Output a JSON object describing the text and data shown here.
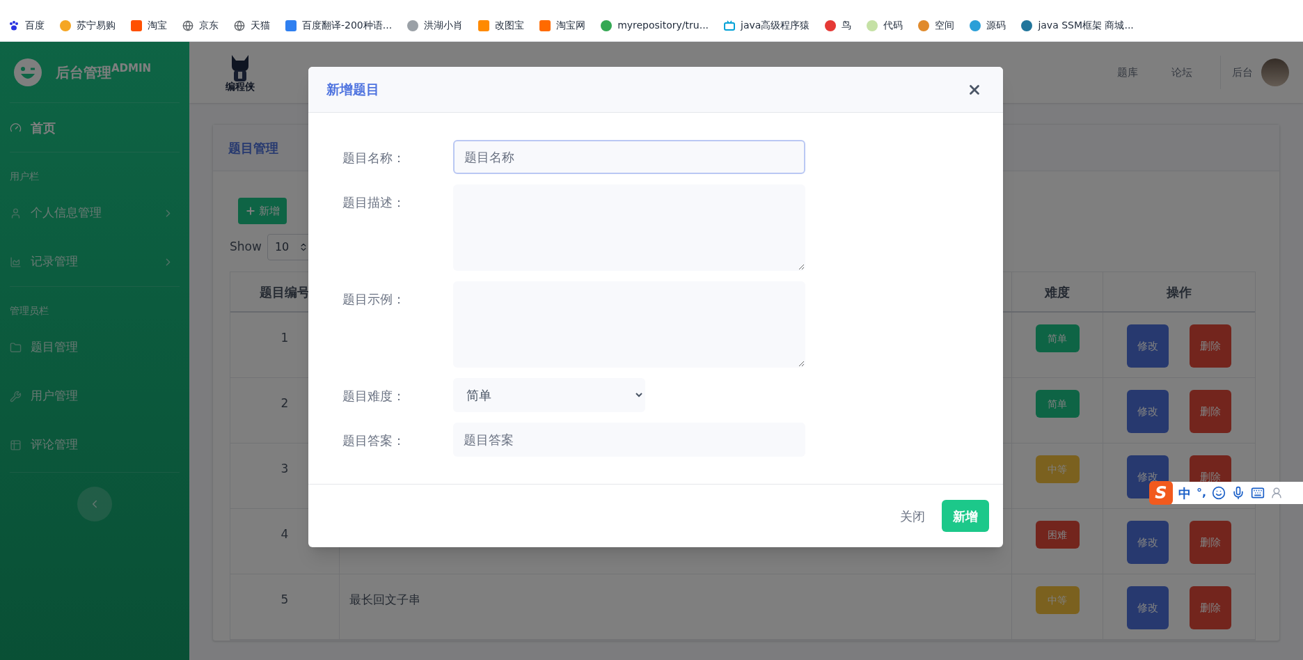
{
  "bookmarks": [
    {
      "label": "百度",
      "kind": "paw",
      "color": "#2932e1"
    },
    {
      "label": "苏宁易购",
      "kind": "circle",
      "color": "#f5a623"
    },
    {
      "label": "淘宝",
      "kind": "square",
      "color": "#ff5000"
    },
    {
      "label": "京东",
      "kind": "globe",
      "color": "#5f6368"
    },
    {
      "label": "天猫",
      "kind": "globe",
      "color": "#5f6368"
    },
    {
      "label": "百度翻译-200种语...",
      "kind": "square",
      "color": "#2f7ff0"
    },
    {
      "label": "洪湖小肖",
      "kind": "circle",
      "color": "#9aa0a6"
    },
    {
      "label": "改图宝",
      "kind": "square",
      "color": "#ff8a00"
    },
    {
      "label": "淘宝网",
      "kind": "square",
      "color": "#ff6a00"
    },
    {
      "label": "myrepository/tru...",
      "kind": "circle",
      "color": "#34a853"
    },
    {
      "label": "java高级程序猿",
      "kind": "tv",
      "color": "#00a1d6"
    },
    {
      "label": "鸟",
      "kind": "circle",
      "color": "#e53935"
    },
    {
      "label": "代码",
      "kind": "circle",
      "color": "#c5e1a5"
    },
    {
      "label": "空间",
      "kind": "circle",
      "color": "#e08a2c"
    },
    {
      "label": "源码",
      "kind": "circle",
      "color": "#2a9fd8"
    },
    {
      "label": "java SSM框架 商城...",
      "kind": "circle",
      "color": "#21759b"
    }
  ],
  "sidebar": {
    "brand": "后台管理$^{ADMIN}$",
    "items": [
      {
        "kind": "link",
        "label": "首页",
        "selected": true,
        "collapsible": false
      },
      {
        "kind": "heading",
        "label": "用户栏"
      },
      {
        "kind": "link",
        "label": "个人信息管理",
        "selected": false,
        "collapsible": true
      },
      {
        "kind": "link",
        "label": "记录管理",
        "selected": false,
        "collapsible": true
      },
      {
        "kind": "heading",
        "label": "管理员栏"
      },
      {
        "kind": "link",
        "label": "题目管理",
        "selected": false,
        "collapsible": false
      },
      {
        "kind": "link",
        "label": "用户管理",
        "selected": false,
        "collapsible": false
      },
      {
        "kind": "link",
        "label": "评论管理",
        "selected": false,
        "collapsible": false
      }
    ]
  },
  "topbar": {
    "logo_text": "编程侠",
    "links": [
      "题库",
      "论坛"
    ],
    "user": "后台"
  },
  "card": {
    "title": "题目管理",
    "add_button": "新增",
    "show_label": "Show",
    "page_size": "10",
    "columns": [
      "题目编号",
      "难度",
      "操作"
    ],
    "rows": [
      {
        "id": "1",
        "difficulty": {
          "label": "简单",
          "kind": "easy"
        },
        "actions": [
          {
            "kind": "edit",
            "label": "修改"
          },
          {
            "kind": "delete",
            "label": "删除"
          }
        ]
      },
      {
        "id": "2",
        "difficulty": {
          "label": "简单",
          "kind": "easy"
        },
        "actions": [
          {
            "kind": "edit",
            "label": "修改"
          },
          {
            "kind": "delete",
            "label": "删除"
          }
        ]
      },
      {
        "id": "3",
        "difficulty": {
          "label": "中等",
          "kind": "medium"
        },
        "actions": [
          {
            "kind": "edit",
            "label": "修改"
          },
          {
            "kind": "delete",
            "label": "删除"
          }
        ]
      },
      {
        "id": "4",
        "difficulty": {
          "label": "困难",
          "kind": "hard"
        },
        "actions": [
          {
            "kind": "edit",
            "label": "修改"
          },
          {
            "kind": "delete",
            "label": "删除"
          }
        ]
      },
      {
        "id": "5",
        "title": "最长回文子串",
        "difficulty": {
          "label": "中等",
          "kind": "medium"
        },
        "actions": [
          {
            "kind": "edit",
            "label": "修改"
          },
          {
            "kind": "delete",
            "label": "删除"
          }
        ]
      }
    ]
  },
  "modal": {
    "title": "新增题目",
    "fields": [
      {
        "kind": "input",
        "label": "题目名称：",
        "placeholder": "题目名称",
        "focused": true
      },
      {
        "kind": "textarea",
        "label": "题目描述：",
        "focused": false
      },
      {
        "kind": "textarea",
        "label": "题目示例：",
        "focused": false
      },
      {
        "kind": "select",
        "label": "题目难度：",
        "value": "简单",
        "focused": false
      },
      {
        "kind": "input",
        "label": "题目答案：",
        "placeholder": "题目答案",
        "focused": false
      }
    ],
    "close_label": "关闭",
    "submit_label": "新增"
  },
  "ime": {
    "logo": "S",
    "mode": "中",
    "punct": "°,"
  }
}
